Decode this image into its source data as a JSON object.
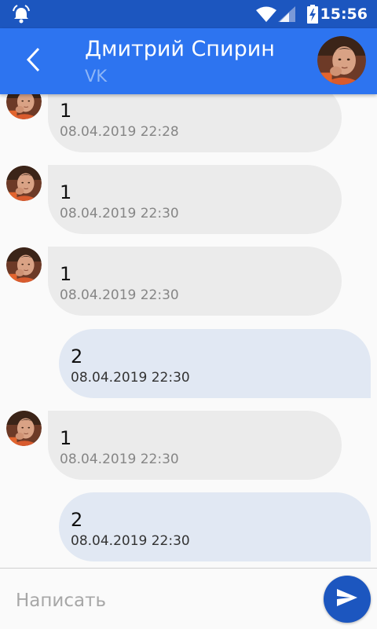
{
  "status_bar": {
    "time": "15:56",
    "icons": [
      "alarm-icon",
      "wifi-icon",
      "signal-icon",
      "battery-charging-icon"
    ]
  },
  "header": {
    "name": "Дмитрий Спирин",
    "subtitle": "VK",
    "back_icon": "chevron-left-icon",
    "avatar_icon": "avatar"
  },
  "messages": [
    {
      "direction": "in",
      "text": "1",
      "time": "08.04.2019 22:28"
    },
    {
      "direction": "in",
      "text": "1",
      "time": "08.04.2019 22:30"
    },
    {
      "direction": "in",
      "text": "1",
      "time": "08.04.2019 22:30"
    },
    {
      "direction": "out",
      "text": "2",
      "time": "08.04.2019 22:30"
    },
    {
      "direction": "in",
      "text": "1",
      "time": "08.04.2019 22:30"
    },
    {
      "direction": "out",
      "text": "2",
      "time": "08.04.2019 22:30"
    }
  ],
  "compose": {
    "placeholder": "Написать",
    "send_icon": "send-icon"
  },
  "colors": {
    "status_bar": "#1c56bf",
    "app_bar": "#2d74f0",
    "incoming_bubble": "#ebebeb",
    "outgoing_bubble": "#e1e8f3",
    "send_button": "#1c56bf"
  }
}
